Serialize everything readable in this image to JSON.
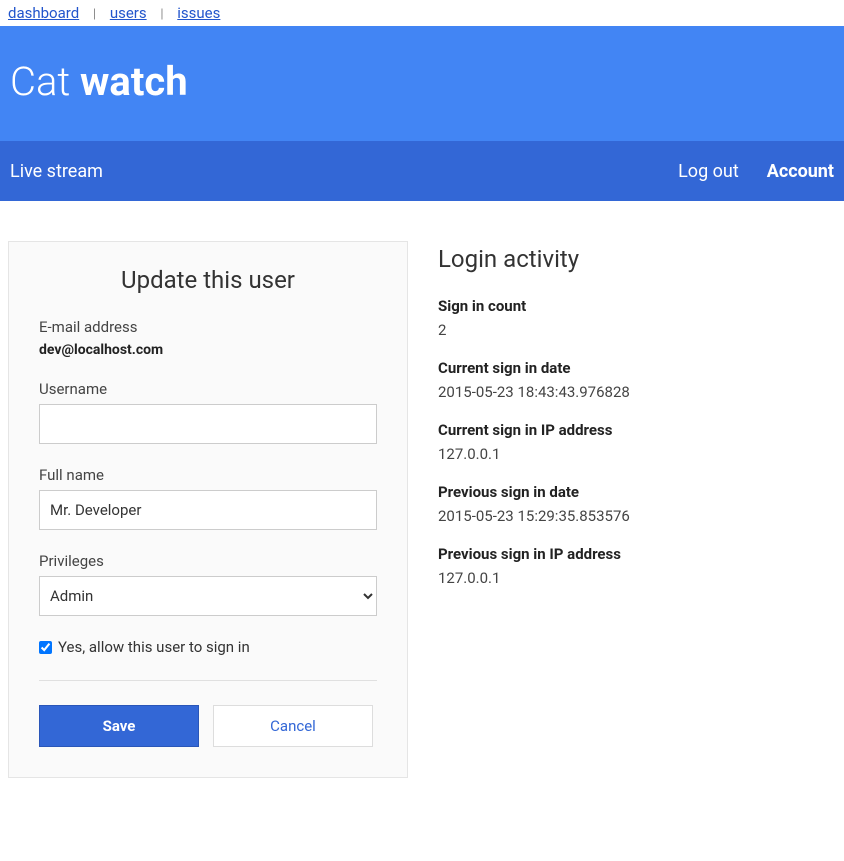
{
  "topnav": {
    "dashboard": "dashboard",
    "users": "users",
    "issues": "issues"
  },
  "brand": {
    "light": "Cat ",
    "bold": "watch"
  },
  "navbar": {
    "live_stream": "Live stream",
    "logout": "Log out",
    "account": "Account"
  },
  "form": {
    "title": "Update this user",
    "email_label": "E-mail address",
    "email_value": "dev@localhost.com",
    "username_label": "Username",
    "username_value": "",
    "fullname_label": "Full name",
    "fullname_value": "Mr. Developer",
    "privileges_label": "Privileges",
    "privileges_value": "Admin",
    "allow_signin_label": "Yes, allow this user to sign in",
    "allow_signin_checked": true,
    "save": "Save",
    "cancel": "Cancel"
  },
  "activity": {
    "title": "Login activity",
    "signin_count_label": "Sign in count",
    "signin_count_value": "2",
    "current_date_label": "Current sign in date",
    "current_date_value": "2015-05-23 18:43:43.976828",
    "current_ip_label": "Current sign in IP address",
    "current_ip_value": "127.0.0.1",
    "previous_date_label": "Previous sign in date",
    "previous_date_value": "2015-05-23 15:29:35.853576",
    "previous_ip_label": "Previous sign in IP address",
    "previous_ip_value": "127.0.0.1"
  }
}
